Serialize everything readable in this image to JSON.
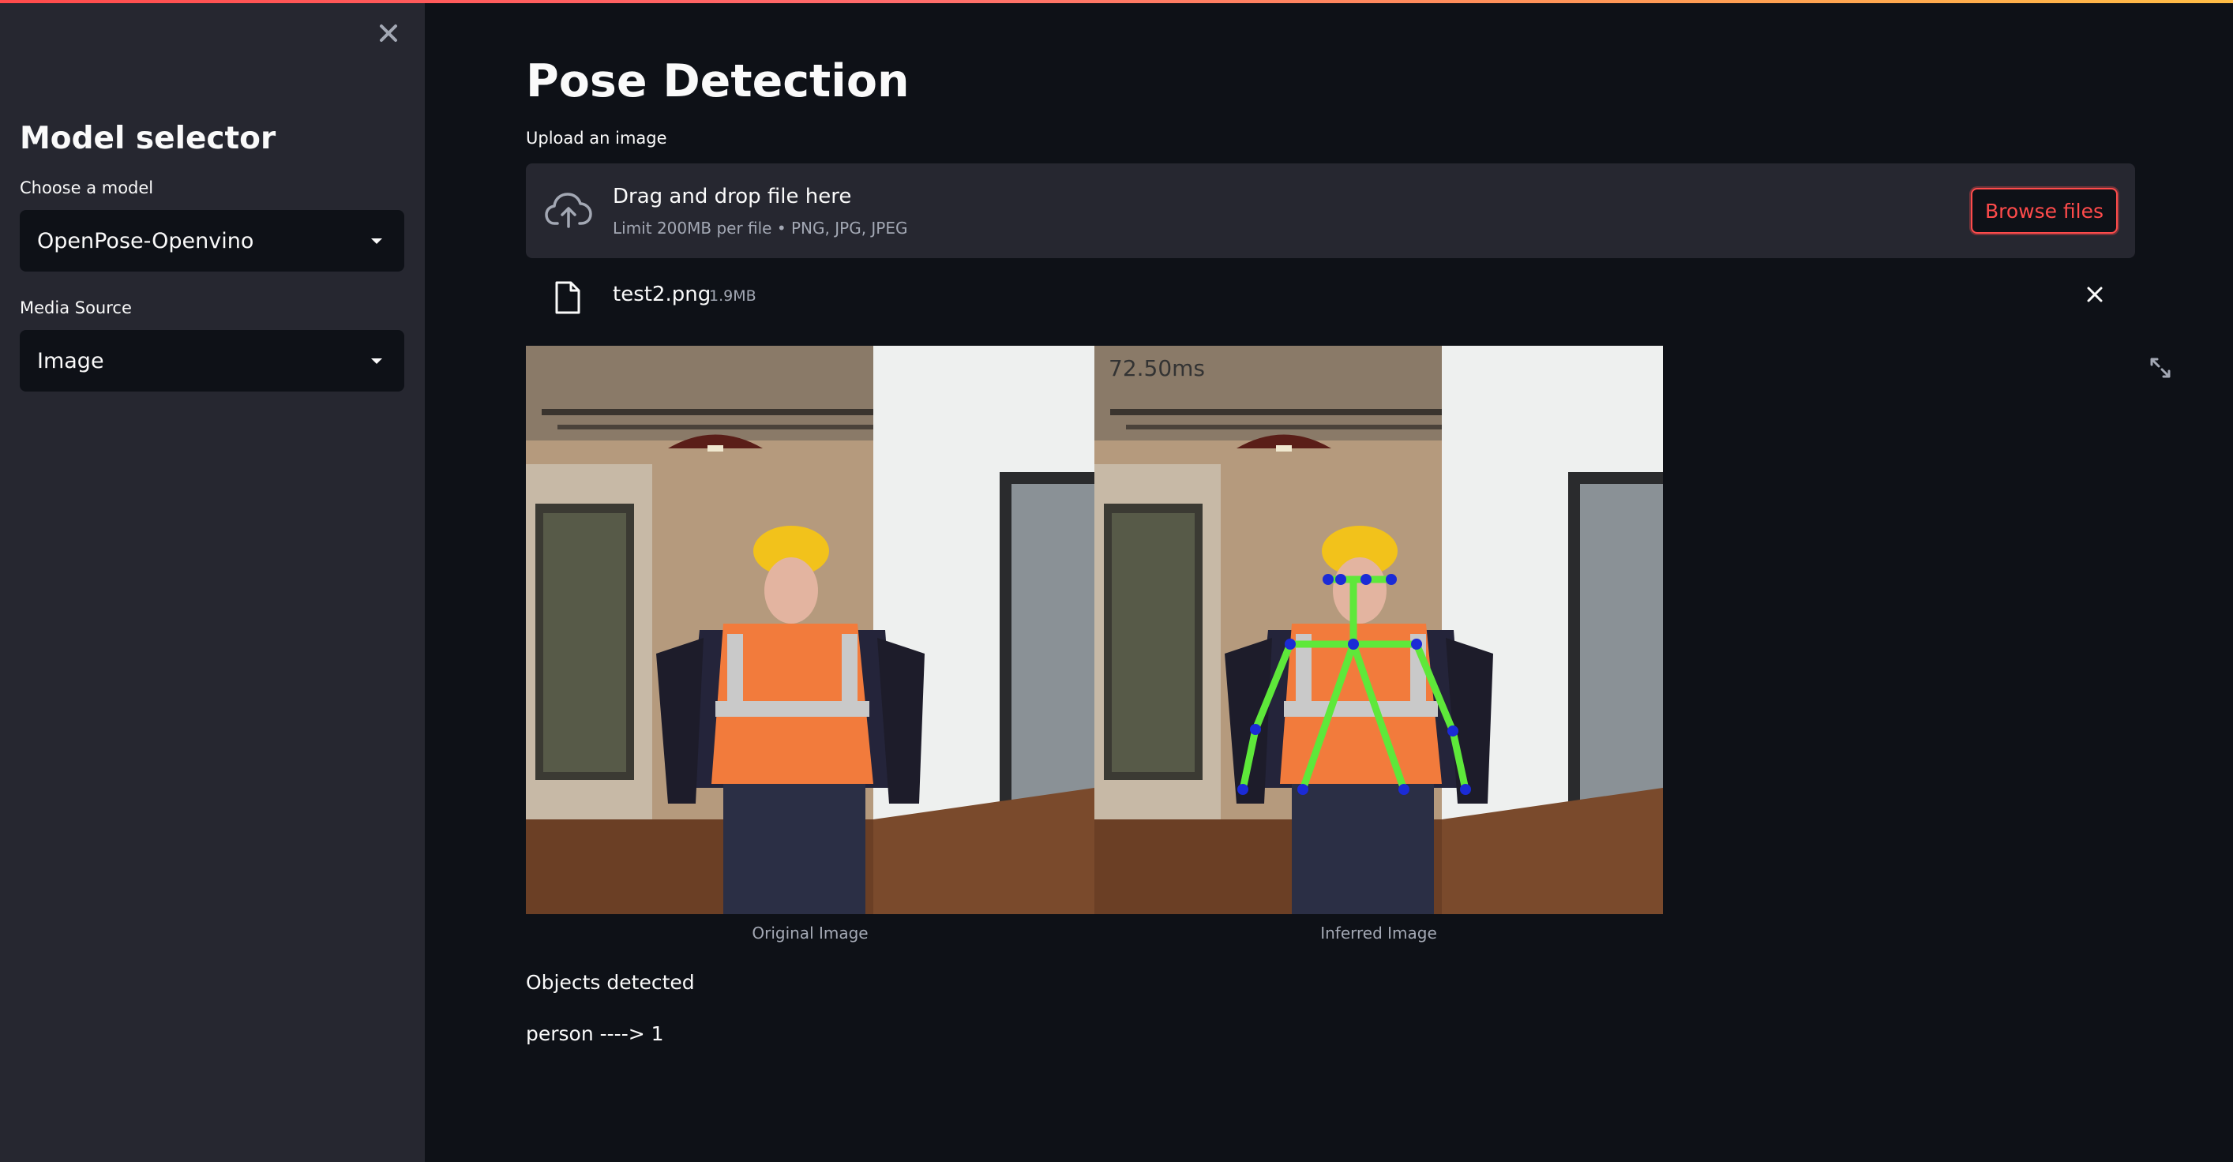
{
  "sidebar": {
    "title": "Model selector",
    "model_label": "Choose a model",
    "model_value": "OpenPose-Openvino",
    "source_label": "Media Source",
    "source_value": "Image",
    "close_icon": "close-icon"
  },
  "main": {
    "title": "Pose Detection",
    "upload_label": "Upload an image",
    "dropzone": {
      "main_text": "Drag and drop file here",
      "sub_text": "Limit 200MB per file • PNG, JPG, JPEG",
      "button_label": "Browse files",
      "icon": "cloud-upload-icon"
    },
    "uploaded_file": {
      "name": "test2.png",
      "size": "1.9MB",
      "icon": "file-icon"
    },
    "images": [
      {
        "caption": "Original Image"
      },
      {
        "caption": "Inferred Image",
        "overlay_text": "72.50ms"
      }
    ],
    "objects_label": "Objects detected",
    "objects": [
      "person ----> 1"
    ]
  },
  "colors": {
    "accent": "#ff4b4b",
    "background": "#0e1117",
    "sidebar": "#262730",
    "skeleton_line": "#5ee83a",
    "skeleton_point": "#1b2bd6"
  }
}
